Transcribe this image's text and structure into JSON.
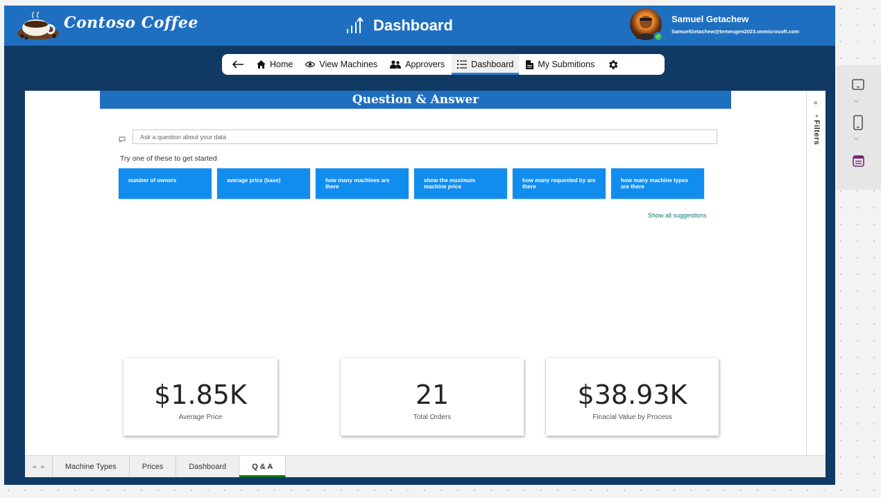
{
  "header": {
    "brand": "Contoso Coffee",
    "page_title": "Dashboard",
    "user_name": "Samuel Getachew",
    "user_email": "SamuelGetachew@temesgen2023.onmicrosoft.com"
  },
  "nav": {
    "items": [
      {
        "label": "Home",
        "icon": "home-icon"
      },
      {
        "label": "View Machines",
        "icon": "eye-icon"
      },
      {
        "label": "Approvers",
        "icon": "users-icon"
      },
      {
        "label": "Dashboard",
        "icon": "list-icon",
        "active": true
      },
      {
        "label": "My Submitions",
        "icon": "document-icon"
      }
    ]
  },
  "qa": {
    "title": "Question & Answer",
    "placeholder": "Ask a question about your data",
    "try_text": "Try one of these to get started",
    "suggestions": [
      "number of owners",
      "average price (base)",
      "how many machines are there",
      "show the maximum machine price",
      "how many requested by are there",
      "how many machine types are there"
    ],
    "show_all": "Show all suggestions"
  },
  "filters": {
    "label": "Filters"
  },
  "cards": [
    {
      "value": "$1.85K",
      "label": "Average Price"
    },
    {
      "value": "21",
      "label": "Total Orders"
    },
    {
      "value": "$38.93K",
      "label": "Finacial Value by Process"
    }
  ],
  "tabs": [
    {
      "label": "Machine Types"
    },
    {
      "label": "Prices"
    },
    {
      "label": "Dashboard"
    },
    {
      "label": "Q & A",
      "active": true
    }
  ],
  "colors": {
    "header_blue": "#1f6fc1",
    "frame_navy": "#103a63",
    "suggestion_blue": "#118df0",
    "active_tab_green": "#107c10"
  }
}
